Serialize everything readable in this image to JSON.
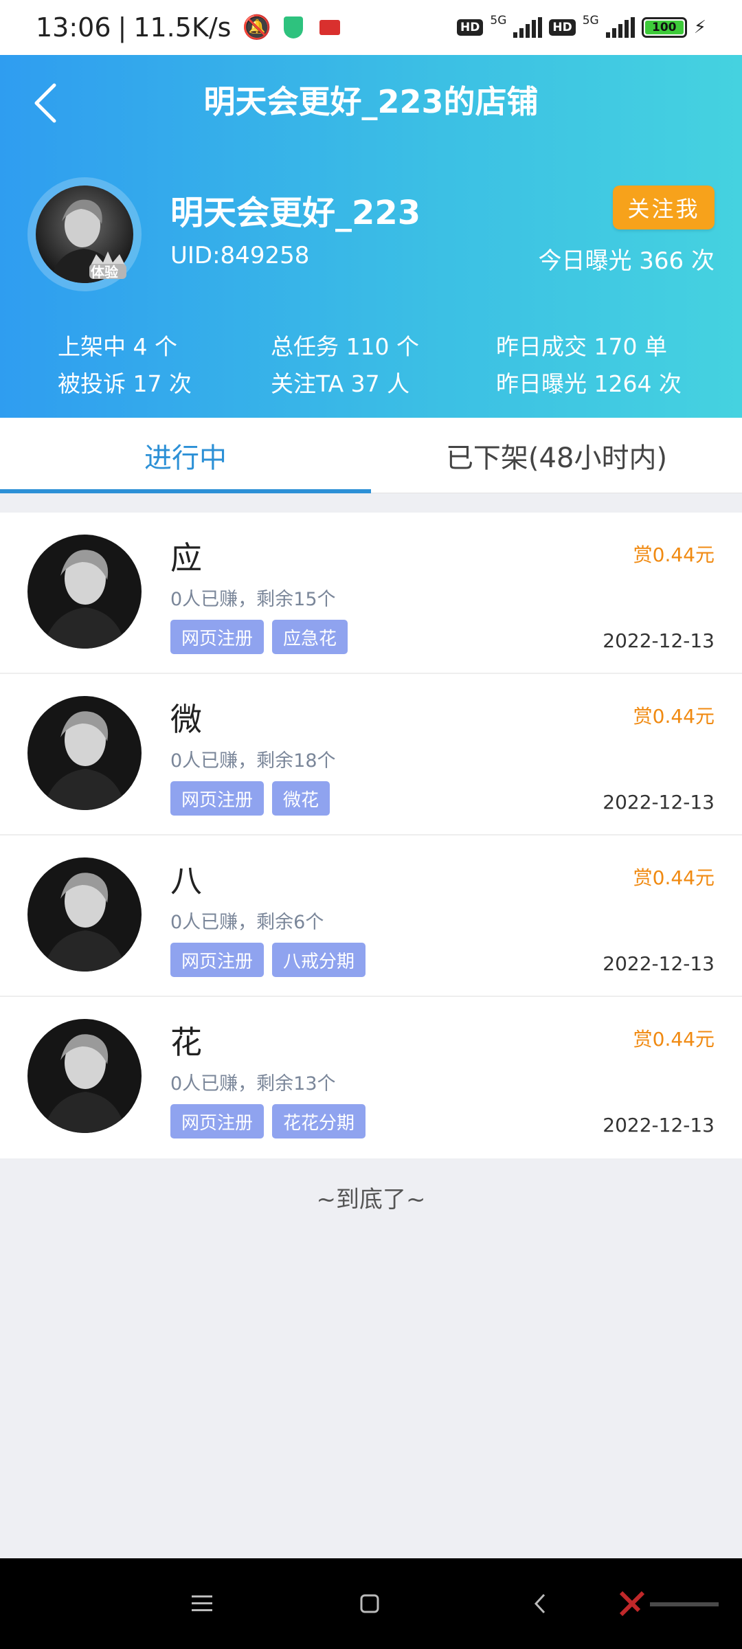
{
  "status_bar": {
    "time": "13:06",
    "speed": "11.5K/s",
    "hd1": "HD",
    "net1": "5G",
    "hd2": "HD",
    "net2": "5G",
    "battery": "100"
  },
  "header": {
    "title": "明天会更好_223的店铺",
    "shop_name": "明天会更好_223",
    "uid": "UID:849258",
    "follow_label": "关注我",
    "today_exposure": "今日曝光 366 次",
    "avatar_badge": "体验"
  },
  "stats": {
    "on_shelf": "上架中 4 个",
    "total_tasks": "总任务 110 个",
    "yesterday_deals": "昨日成交 170 单",
    "complaints": "被投诉 17 次",
    "followers": "关注TA 37 人",
    "yesterday_exposure": "昨日曝光 1264 次"
  },
  "tabs": [
    {
      "label": "进行中",
      "active": true
    },
    {
      "label": "已下架(48小时内)",
      "active": false
    }
  ],
  "tasks": [
    {
      "title": "应",
      "sub": "0人已赚，剩余15个",
      "tags": [
        "网页注册",
        "应急花"
      ],
      "reward": "赏0.44元",
      "date": "2022-12-13"
    },
    {
      "title": "微",
      "sub": "0人已赚，剩余18个",
      "tags": [
        "网页注册",
        "微花"
      ],
      "reward": "赏0.44元",
      "date": "2022-12-13"
    },
    {
      "title": "八",
      "sub": "0人已赚，剩余6个",
      "tags": [
        "网页注册",
        "八戒分期"
      ],
      "reward": "赏0.44元",
      "date": "2022-12-13"
    },
    {
      "title": "花",
      "sub": "0人已赚，剩余13个",
      "tags": [
        "网页注册",
        "花花分期"
      ],
      "reward": "赏0.44元",
      "date": "2022-12-13"
    }
  ],
  "end_text": "~到底了~",
  "colors": {
    "accent": "#2c90d6",
    "follow": "#f7a21b",
    "reward": "#f08a12",
    "tag": "#8fa3ef"
  }
}
